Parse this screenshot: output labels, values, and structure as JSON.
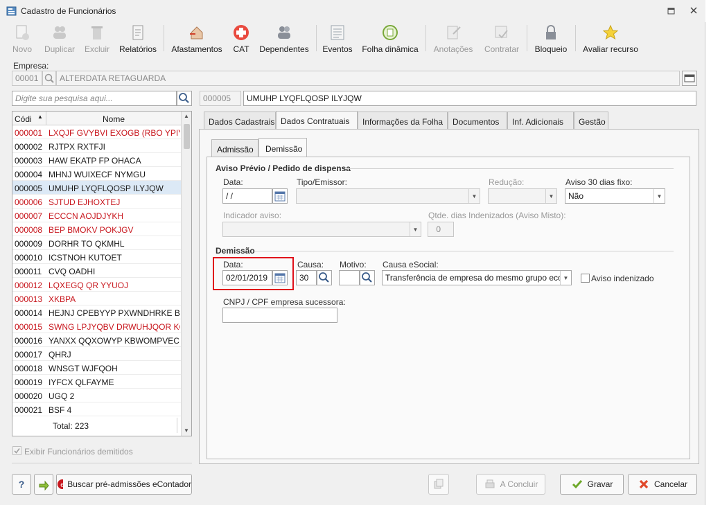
{
  "window": {
    "title": "Cadastro de Funcionários"
  },
  "toolbar": [
    {
      "id": "novo",
      "label": "Novo",
      "enabled": false,
      "icon": "new-document-icon"
    },
    {
      "id": "duplicar",
      "label": "Duplicar",
      "enabled": false,
      "icon": "people-icon"
    },
    {
      "id": "excluir",
      "label": "Excluir",
      "enabled": false,
      "icon": "trash-icon"
    },
    {
      "id": "relatorios",
      "label": "Relatórios",
      "enabled": true,
      "icon": "report-icon"
    },
    {
      "id": "afastamentos",
      "label": "Afastamentos",
      "enabled": true,
      "icon": "house-arrow-icon"
    },
    {
      "id": "cat",
      "label": "CAT",
      "enabled": true,
      "icon": "red-cross-icon"
    },
    {
      "id": "dependentes",
      "label": "Dependentes",
      "enabled": true,
      "icon": "people-icon"
    },
    {
      "id": "eventos",
      "label": "Eventos",
      "enabled": true,
      "icon": "list-icon"
    },
    {
      "id": "folha",
      "label": "Folha dinâmica",
      "enabled": true,
      "icon": "refresh-sheet-icon"
    },
    {
      "id": "anotacoes",
      "label": "Anotações",
      "enabled": false,
      "icon": "note-icon"
    },
    {
      "id": "contratar",
      "label": "Contratar",
      "enabled": false,
      "icon": "contract-icon"
    },
    {
      "id": "bloqueio",
      "label": "Bloqueio",
      "enabled": true,
      "icon": "lock-icon"
    },
    {
      "id": "avaliar",
      "label": "Avaliar recurso",
      "enabled": true,
      "icon": "star-icon"
    }
  ],
  "empresa": {
    "label": "Empresa:",
    "code": "00001",
    "name": "ALTERDATA RETAGUARDA"
  },
  "search": {
    "placeholder": "Digite sua pesquisa aqui..."
  },
  "employee": {
    "code": "000005",
    "name": "UMUHP LYQFLQOSP ILYJQW"
  },
  "grid": {
    "headers": [
      "Códi",
      "Nome"
    ],
    "rows": [
      {
        "code": "000001",
        "name": "LXQJF GVYBVI EXOGB (RBO YPIYB)",
        "red": true
      },
      {
        "code": "000002",
        "name": "RJTPX RXTFJI",
        "red": false
      },
      {
        "code": "000003",
        "name": "HAW EKATP FP OHACA",
        "red": false
      },
      {
        "code": "000004",
        "name": "MHNJ WUIXECF NYMGU",
        "red": false
      },
      {
        "code": "000005",
        "name": "UMUHP LYQFLQOSP ILYJQW",
        "red": false,
        "selected": true
      },
      {
        "code": "000006",
        "name": "SJTUD EJHOXTEJ",
        "red": true
      },
      {
        "code": "000007",
        "name": "ECCCN  AOJDJYKH",
        "red": true
      },
      {
        "code": "000008",
        "name": "BEP BMOKV POKJGV",
        "red": true
      },
      {
        "code": "000009",
        "name": "DORHR TO QKMHL",
        "red": false
      },
      {
        "code": "000010",
        "name": "ICSTNOH KUTOET",
        "red": false
      },
      {
        "code": "000011",
        "name": "CVQ OADHI",
        "red": false
      },
      {
        "code": "000012",
        "name": "LQXEGQ QR YYUOJ",
        "red": true
      },
      {
        "code": "000013",
        "name": "XKBPA",
        "red": true
      },
      {
        "code": "000014",
        "name": "HEJNJ CPEBYYP PXWNDHRKE BTB J",
        "red": false
      },
      {
        "code": "000015",
        "name": "SWNG LPJYQBV DRWUHJQOR KQI Y",
        "red": true
      },
      {
        "code": "000016",
        "name": "YANXX QQXOWYP KBWOMPVEC A",
        "red": false
      },
      {
        "code": "000017",
        "name": "QHRJ",
        "red": false
      },
      {
        "code": "000018",
        "name": "WNSGT WJFQOH",
        "red": false
      },
      {
        "code": "000019",
        "name": "IYFCX QLFAYME",
        "red": false
      },
      {
        "code": "000020",
        "name": "UGQ 2",
        "red": false
      },
      {
        "code": "000021",
        "name": "BSF 4",
        "red": false
      }
    ],
    "total": "Total: 223"
  },
  "show_dismissed": "Exibir Funcionários demitidos",
  "tabs": [
    "Dados Cadastrais",
    "Dados Contratuais",
    "Informações da Folha",
    "Documentos",
    "Inf. Adicionais",
    "Gestão"
  ],
  "subtabs": [
    "Admissão",
    "Demissão"
  ],
  "aviso": {
    "section": "Aviso Prévio / Pedido de dispensa",
    "data_label": "Data:",
    "data_value": " / /",
    "tipo_label": "Tipo/Emissor:",
    "reducao_label": "Redução:",
    "aviso30_label": "Aviso 30 dias fixo:",
    "aviso30_value": "Não",
    "indicador_label": "Indicador aviso:",
    "qtde_label": "Qtde. dias Indenizados (Aviso Misto):",
    "qtde_value": "0"
  },
  "demissao": {
    "section": "Demissão",
    "data_label": "Data:",
    "data_value": "02/01/2019",
    "causa_label": "Causa:",
    "causa_value": "30",
    "motivo_label": "Motivo:",
    "motivo_value": "",
    "esocial_label": "Causa eSocial:",
    "esocial_value": "Transferência de empresa do mesmo grupo eco",
    "aviso_indenizado": "Aviso indenizado",
    "cnpj_label": "CNPJ / CPF empresa sucessora:",
    "cnpj_value": ""
  },
  "footer": {
    "help": "?",
    "buscar": "Buscar pré-admissões eContador",
    "concluir": "A Concluir",
    "gravar": "Gravar",
    "cancelar": "Cancelar"
  },
  "colors": {
    "red_text": "#c8171e",
    "highlight_box": "#e0101a",
    "selected_row": "#dce9f6"
  }
}
